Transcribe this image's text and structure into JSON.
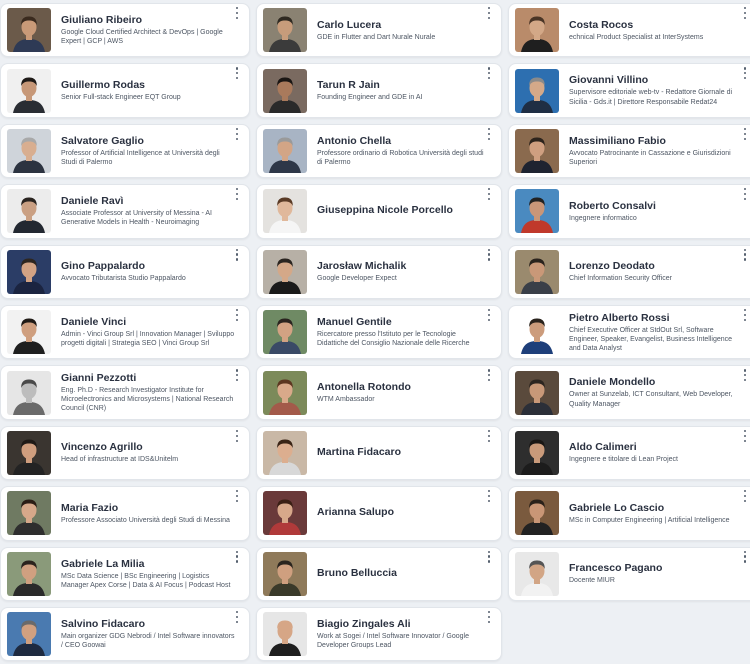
{
  "speakers": [
    {
      "name": "Giuliano Ribeiro",
      "role": "Google Cloud Certified Architect & DevOps | Google Expert | GCP | AWS",
      "bg": "#6b5a4a",
      "skin": "#c99a78",
      "hair": "#3a2a1e",
      "shirt": "#2e3a55"
    },
    {
      "name": "Carlo Lucera",
      "role": "GDE in Flutter and Dart Nurale Nurale",
      "bg": "#8a8272",
      "skin": "#c79c7b",
      "hair": "#2f2a22",
      "shirt": "#3b3b3b"
    },
    {
      "name": "Costa Rocos",
      "role": "echnical Product Specialist at InterSystems",
      "bg": "#b98b6a",
      "skin": "#d3a887",
      "hair": "#4a3526",
      "shirt": "#1f1f1f"
    },
    {
      "name": "Guillermo Rodas",
      "role": "Senior Full-stack Engineer EQT Group",
      "bg": "#f0f0f0",
      "skin": "#c79878",
      "hair": "#1e1a17",
      "shirt": "#2a2d33"
    },
    {
      "name": "Tarun R Jain",
      "role": "Founding Engineer and GDE in AI",
      "bg": "#7a6a60",
      "skin": "#a97a5c",
      "hair": "#1a1614",
      "shirt": "#2a2a2a"
    },
    {
      "name": "Giovanni Villino",
      "role": "Supervisore editoriale web-tv - Redattore Giornale di Sicilia - Gds.it | Direttore Responsabile Redat24",
      "bg": "#2d6fb0",
      "skin": "#d4a989",
      "hair": "#8a8a8a",
      "shirt": "#1f2e44"
    },
    {
      "name": "Salvatore Gaglio",
      "role": "Professor of Artificial Intelligence at Università degli Studi di Palermo",
      "bg": "#cfd4da",
      "skin": "#d8ae90",
      "hair": "#a9a9a9",
      "shirt": "#2c3340"
    },
    {
      "name": "Antonio Chella",
      "role": "Professore ordinario di Robotica Università degli studi di Palermo",
      "bg": "#a8b4c4",
      "skin": "#d2a586",
      "hair": "#9a9a9a",
      "shirt": "#2e3748"
    },
    {
      "name": "Massimiliano Fabio",
      "role": "Avvocato Patrocinante in Cassazione e Giurisdizioni Superiori",
      "bg": "#8a6a4e",
      "skin": "#cf9f80",
      "hair": "#2d241d",
      "shirt": "#1e2330"
    },
    {
      "name": "Daniele Ravì",
      "role": "Associate Professor at University of Messina - AI Generative Models in Health - Neuroimaging",
      "bg": "#ececec",
      "skin": "#caa083",
      "hair": "#2a2420",
      "shirt": "#232831"
    },
    {
      "name": "Giuseppina Nicole Porcello",
      "role": "",
      "bg": "#e4e2df",
      "skin": "#e0b89b",
      "hair": "#5a3b26",
      "shirt": "#f5f5f5"
    },
    {
      "name": "Roberto Consalvi",
      "role": "Ingegnere informatico",
      "bg": "#4a8ac0",
      "skin": "#c99678",
      "hair": "#222222",
      "shirt": "#c0392b"
    },
    {
      "name": "Gino Pappalardo",
      "role": "Avvocato Tributarista Studio Pappalardo",
      "bg": "#2b3d66",
      "skin": "#d3a384",
      "hair": "#2e2620",
      "shirt": "#1b2440"
    },
    {
      "name": "Jarosław Michalik",
      "role": "Google Developer Expect",
      "bg": "#b7b0a6",
      "skin": "#d4a888",
      "hair": "#2a2520",
      "shirt": "#1a1a1a"
    },
    {
      "name": "Lorenzo Deodato",
      "role": "Chief Information Security Officer",
      "bg": "#9a8a6e",
      "skin": "#c99878",
      "hair": "#2a231d",
      "shirt": "#3a3f48"
    },
    {
      "name": "Daniele Vinci",
      "role": "Admin - Vinci Group Srl | Innovation Manager | Sviluppo progetti digitali | Strategia SEO | Vinci Group Srl",
      "bg": "#f2f2f2",
      "skin": "#cf9f7f",
      "hair": "#1f1a16",
      "shirt": "#1f1f1f"
    },
    {
      "name": "Manuel Gentile",
      "role": "Ricercatore presso l'Istituto per le Tecnologie Didattiche del Consiglio Nazionale delle Ricerche",
      "bg": "#6f8a64",
      "skin": "#d2a283",
      "hair": "#2a241f",
      "shirt": "#3a4a66"
    },
    {
      "name": "Pietro Alberto Rossi",
      "role": "Chief Executive Officer at StdOut Srl, Software Engineer, Speaker, Evangelist, Business Intelligence and Data Analyst",
      "bg": "#ffffff",
      "skin": "#cc9c7c",
      "hair": "#2a231d",
      "shirt": "#1e3f7a"
    },
    {
      "name": "Gianni Pezzotti",
      "role": "Eng. Ph.D - Research Investigator Institute for Microelectronics and Microsystems | National Research Council (CNR)",
      "bg": "#e6e6e6",
      "skin": "#bdbdbd",
      "hair": "#4a4a4a",
      "shirt": "#6a6a6a"
    },
    {
      "name": "Antonella Rotondo",
      "role": "WTM Ambassador",
      "bg": "#7c8a5a",
      "skin": "#d9a98a",
      "hair": "#5c3620",
      "shirt": "#a35a4a"
    },
    {
      "name": "Daniele Mondello",
      "role": "Owner at Sunzelab, ICT Consultant, Web Developer, Quality Manager",
      "bg": "#5a4a3c",
      "skin": "#c89878",
      "hair": "#2c2520",
      "shirt": "#2b2f38"
    },
    {
      "name": "Vincenzo Agrillo",
      "role": "Head of infrastructure at IDS&Unitelm",
      "bg": "#3a3530",
      "skin": "#cf9e7e",
      "hair": "#1f1a16",
      "shirt": "#232323"
    },
    {
      "name": "Martina Fidacaro",
      "role": "",
      "bg": "#c9b8a6",
      "skin": "#dcae8f",
      "hair": "#3a2416",
      "shirt": "#d8d8d8"
    },
    {
      "name": "Aldo Calimeri",
      "role": "Ingegnere e titolare di Lean Project",
      "bg": "#2e2e2e",
      "skin": "#c99a7a",
      "hair": "#1a1715",
      "shirt": "#1c1c1c"
    },
    {
      "name": "Maria Fazio",
      "role": "Professore Associato Università degli Studi di Messina",
      "bg": "#6f7a62",
      "skin": "#d6a88a",
      "hair": "#2a1d15",
      "shirt": "#2e2e2e"
    },
    {
      "name": "Arianna Salupo",
      "role": "",
      "bg": "#6a3a3a",
      "skin": "#d7a88a",
      "hair": "#3a1f14",
      "shirt": "#b03a3a"
    },
    {
      "name": "Gabriele Lo Cascio",
      "role": "MSc in Computer Engineering | Artificial Intelligence",
      "bg": "#7a5a3e",
      "skin": "#c99676",
      "hair": "#2a211a",
      "shirt": "#222222"
    },
    {
      "name": "Gabriele La Milia",
      "role": "MSc Data Science | BSc Engineering | Logistics Manager Apex Corse | Data & AI Focus | Podcast Host",
      "bg": "#8a9a7a",
      "skin": "#d0a080",
      "hair": "#2a231d",
      "shirt": "#2a2a2a"
    },
    {
      "name": "Bruno Belluccia",
      "role": "",
      "bg": "#8f7a5a",
      "skin": "#cf9f7f",
      "hair": "#2a241e",
      "shirt": "#3a3a2a"
    },
    {
      "name": "Francesco Pagano",
      "role": "Docente MIUR",
      "bg": "#e8e8e8",
      "skin": "#d2a585",
      "hair": "#555555",
      "shirt": "#f2f2f2"
    },
    {
      "name": "Salvino Fidacaro",
      "role": "Main organizer GDG Nebrodi / Intel Software innovators / CEO Goowai",
      "bg": "#4a7ab0",
      "skin": "#d0a080",
      "hair": "#6a6a6a",
      "shirt": "#1e2a40"
    },
    {
      "name": "Biagio Zingales Ali",
      "role": "Work at Sogei / Intel Software Innovator / Google Developer Groups Lead",
      "bg": "#e6e6e6",
      "skin": "#d6a686",
      "hair": "#d6a686",
      "shirt": "#1e1e1e"
    }
  ]
}
